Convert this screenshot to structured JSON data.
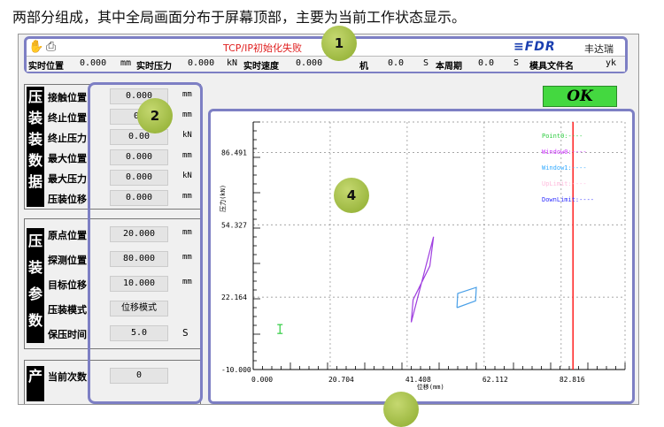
{
  "caption": "两部分组成，其中全局画面分布于屏幕顶部，主要为当前工作状态显示。",
  "header": {
    "status_text": "TCP/IP初始化失败",
    "logo_text": "FDR",
    "brand": "丰达瑞",
    "readouts": [
      {
        "label": "实时位置",
        "value": "0.000",
        "unit": "mm"
      },
      {
        "label": "实时压力",
        "value": "0.000",
        "unit": "kN"
      },
      {
        "label": "实时速度",
        "value": "0.000",
        "unit": ""
      },
      {
        "label": "机",
        "value": "0.0",
        "unit": "S"
      },
      {
        "label": "本周期",
        "value": "0.0",
        "unit": "S"
      },
      {
        "label": "模具文件名",
        "value": "yk",
        "unit": ""
      }
    ]
  },
  "badges": [
    "1",
    "2",
    "4"
  ],
  "press_data": {
    "title_chars": [
      "压",
      "装",
      "装",
      "数",
      "据"
    ],
    "rows": [
      {
        "label": "接触位置",
        "value": "0.000",
        "unit": "mm"
      },
      {
        "label": "终止位置",
        "value": "0.",
        "unit": "mm"
      },
      {
        "label": "终止压力",
        "value": "0.00",
        "unit": "kN"
      },
      {
        "label": "最大位置",
        "value": "0.000",
        "unit": "mm"
      },
      {
        "label": "最大压力",
        "value": "0.000",
        "unit": "kN"
      },
      {
        "label": "压装位移",
        "value": "0.000",
        "unit": "mm"
      }
    ]
  },
  "press_params": {
    "title_chars": [
      "压",
      "装",
      "参",
      "数"
    ],
    "rows": [
      {
        "label": "原点位置",
        "value": "20.000",
        "unit": "mm"
      },
      {
        "label": "探测位置",
        "value": "80.000",
        "unit": "mm"
      },
      {
        "label": "目标位移",
        "value": "10.000",
        "unit": "mm"
      },
      {
        "label": "压装模式",
        "value": "位移模式",
        "unit": ""
      },
      {
        "label": "保压时间",
        "value": "5.0",
        "unit": "S"
      }
    ]
  },
  "production": {
    "title_chars": [
      "产"
    ],
    "rows": [
      {
        "label": "当前次数",
        "value": "0",
        "unit": ""
      }
    ]
  },
  "ok_button": "OK",
  "chart_data": {
    "type": "line",
    "xlabel": "位移(mm)",
    "ylabel": "压力(kN)",
    "x_ticks": [
      "0.000",
      "20.704",
      "41.408",
      "62.112",
      "82.816"
    ],
    "y_ticks": [
      "86.491",
      "54.327",
      "22.164",
      "-10.000"
    ],
    "xlim": [
      0,
      100
    ],
    "ylim": [
      -10,
      100
    ],
    "legend_placement": "top-right",
    "legend": [
      {
        "name": "Point0",
        "color": "#2ecc40"
      },
      {
        "name": "Window0",
        "color": "#cc33ff"
      },
      {
        "name": "Window1",
        "color": "#33aaff"
      },
      {
        "name": "UpLimit",
        "color": "#ffbbdd"
      },
      {
        "name": "DownLimit",
        "color": "#3333ff"
      }
    ],
    "series": [
      {
        "name": "Window0",
        "color": "#a040e0",
        "points": [
          [
            42.5,
            11
          ],
          [
            48.5,
            49
          ],
          [
            47.5,
            36
          ],
          [
            43,
            21
          ],
          [
            42.5,
            11
          ]
        ]
      },
      {
        "name": "Window1",
        "color": "#4aa0e8",
        "points": [
          [
            54.8,
            17.5
          ],
          [
            59.8,
            20.5
          ],
          [
            60,
            26.5
          ],
          [
            55,
            23.8
          ],
          [
            54.8,
            17.5
          ]
        ]
      }
    ],
    "point_marker": {
      "x": 7.2,
      "y": 8
    },
    "vline": {
      "x": 86,
      "color": "#ff2020"
    },
    "grid": true
  }
}
